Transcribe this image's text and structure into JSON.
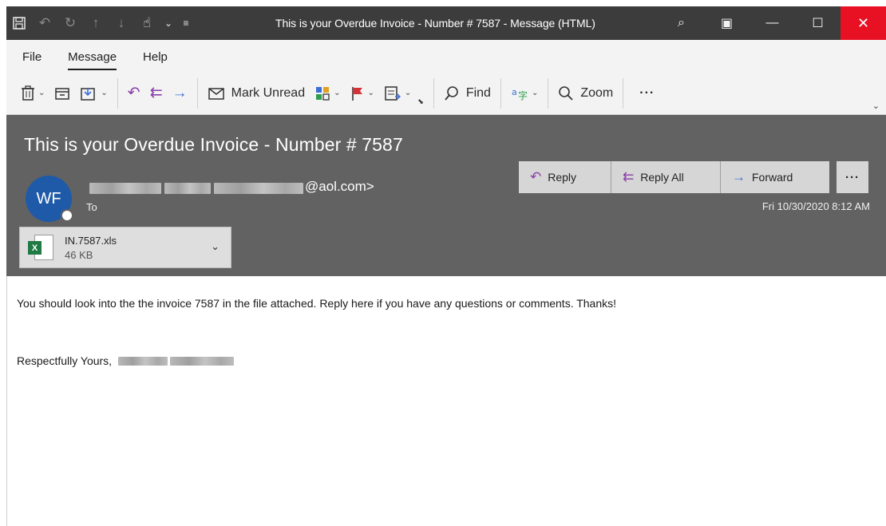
{
  "titlebar": {
    "title": "This is your Overdue Invoice - Number # 7587  -  Message (HTML)",
    "icons": [
      "save-icon",
      "undo-icon",
      "redo-icon",
      "up-arrow-icon",
      "down-arrow-icon",
      "touch-mode-icon",
      "customize-icon"
    ],
    "search_icon": "⌕",
    "restore_icon": "▣",
    "minimize_icon": "—",
    "maximize_icon": "☐",
    "close_icon": "✕"
  },
  "menu": {
    "items": [
      "File",
      "Message",
      "Help"
    ],
    "active": "Message"
  },
  "ribbon": {
    "mark_unread": "Mark Unread",
    "find": "Find",
    "zoom": "Zoom",
    "more": "···"
  },
  "header": {
    "subject": "This is your Overdue Invoice - Number # 7587",
    "avatar_initials": "WF",
    "sender_domain": "@aol.com>",
    "to_label": "To",
    "date": "Fri 10/30/2020 8:12 AM",
    "actions": {
      "reply": "Reply",
      "reply_all": "Reply All",
      "forward": "Forward",
      "more": "···"
    },
    "attachment": {
      "name": "IN.7587.xls",
      "size": "46 KB"
    }
  },
  "body": {
    "line1": "You should look into the the invoice 7587 in the file attached. Reply here if you have any questions or comments. Thanks!",
    "signoff": "Respectfully Yours,"
  },
  "colors": {
    "titlebar_bg": "#3c3c3c",
    "header_bg": "#626262",
    "close_red": "#e81123",
    "avatar_blue": "#1f5aa8",
    "reply_purple": "#8a3ea8",
    "forward_blue": "#3b6fd6",
    "excel_green": "#1f7a43"
  }
}
